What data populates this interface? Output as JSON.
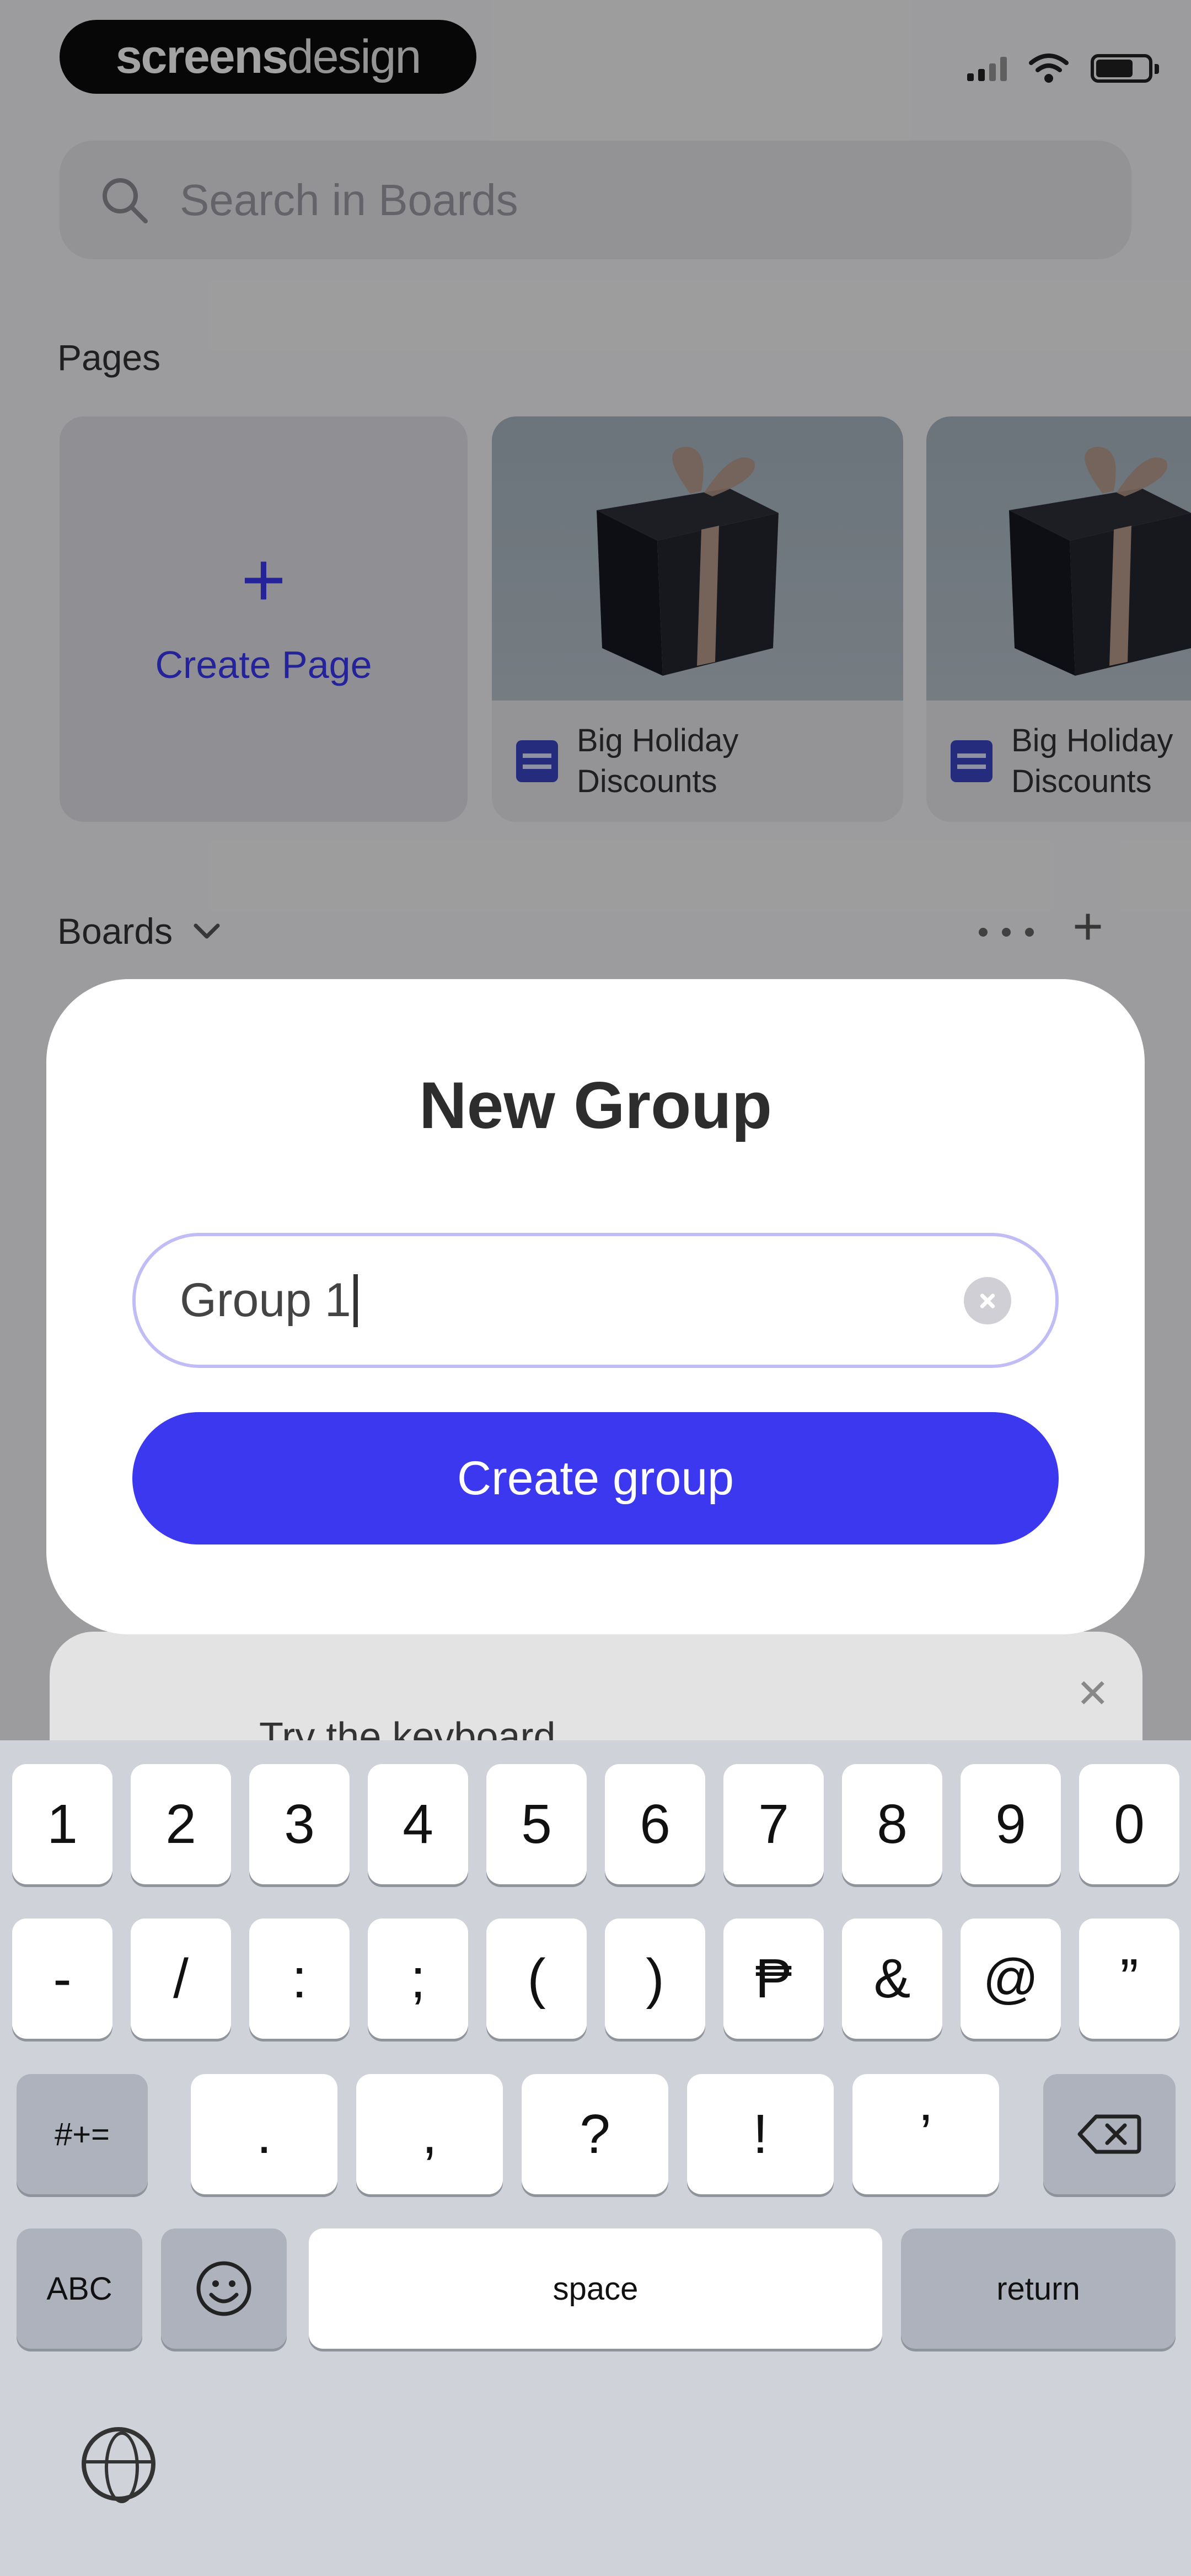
{
  "status_bar": {
    "brand_main": "screens",
    "brand_sub": "design"
  },
  "search": {
    "placeholder": "Search in Boards"
  },
  "pages": {
    "title": "Pages",
    "create_label": "Create Page",
    "cards": [
      {
        "title_line1": "Big Holiday",
        "title_line2": "Discounts"
      },
      {
        "title_line1": "Big Holiday",
        "title_line2": "Discounts"
      }
    ]
  },
  "boards": {
    "title": "Boards"
  },
  "modal": {
    "title": "New Group",
    "input_value": "Group 1",
    "submit_label": "Create group"
  },
  "peek_card": {
    "text": "Try the keyboard"
  },
  "keyboard": {
    "row1": [
      "1",
      "2",
      "3",
      "4",
      "5",
      "6",
      "7",
      "8",
      "9",
      "0"
    ],
    "row2": [
      "-",
      "/",
      ":",
      ";",
      "(",
      ")",
      "₱",
      "&",
      "@",
      "”"
    ],
    "row3": [
      ".",
      ",",
      "?",
      "!",
      "’"
    ],
    "symbols_key": "#+=",
    "abc_key": "ABC",
    "space_key": "space",
    "return_key": "return"
  },
  "colors": {
    "accent": "#3b38f0",
    "overlay": "rgba(0,0,0,0.36)"
  },
  "icons": [
    "search-icon",
    "signal-icon",
    "wifi-icon",
    "battery-icon",
    "plus-icon",
    "document-icon",
    "chevron-down-icon",
    "more-icon",
    "clear-icon",
    "delete-icon",
    "emoji-icon",
    "globe-icon",
    "close-icon"
  ]
}
